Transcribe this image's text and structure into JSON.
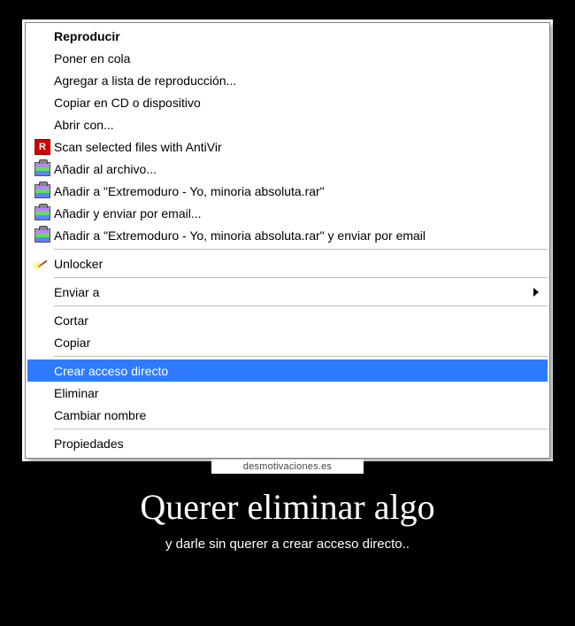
{
  "menu": {
    "items": [
      {
        "label": "Reproducir",
        "bold": true,
        "icon": null
      },
      {
        "label": "Poner en cola",
        "icon": null
      },
      {
        "label": "Agregar a lista de reproducción...",
        "icon": null
      },
      {
        "label": "Copiar en CD o dispositivo",
        "icon": null
      },
      {
        "label": "Abrir con...",
        "icon": null
      },
      {
        "label": "Scan selected files with AntiVir",
        "icon": "antivir"
      },
      {
        "label": "Añadir al archivo...",
        "icon": "winrar"
      },
      {
        "label": "Añadir a \"Extremoduro - Yo, minoria absoluta.rar\"",
        "icon": "winrar"
      },
      {
        "label": "Añadir y enviar por email...",
        "icon": "winrar"
      },
      {
        "label": "Añadir a \"Extremoduro - Yo, minoria absoluta.rar\" y enviar por email",
        "icon": "winrar"
      },
      {
        "separator": true
      },
      {
        "label": "Unlocker",
        "icon": "unlocker"
      },
      {
        "separator": true
      },
      {
        "label": "Enviar a",
        "icon": null,
        "submenu": true
      },
      {
        "separator": true
      },
      {
        "label": "Cortar",
        "icon": null
      },
      {
        "label": "Copiar",
        "icon": null
      },
      {
        "separator": true
      },
      {
        "label": "Crear acceso directo",
        "icon": null,
        "selected": true
      },
      {
        "label": "Eliminar",
        "icon": null
      },
      {
        "label": "Cambiar nombre",
        "icon": null
      },
      {
        "separator": true
      },
      {
        "label": "Propiedades",
        "icon": null
      }
    ]
  },
  "poster": {
    "watermark": "desmotivaciones.es",
    "title": "Querer eliminar algo",
    "subtitle": "y darle sin querer a crear acceso directo.."
  }
}
